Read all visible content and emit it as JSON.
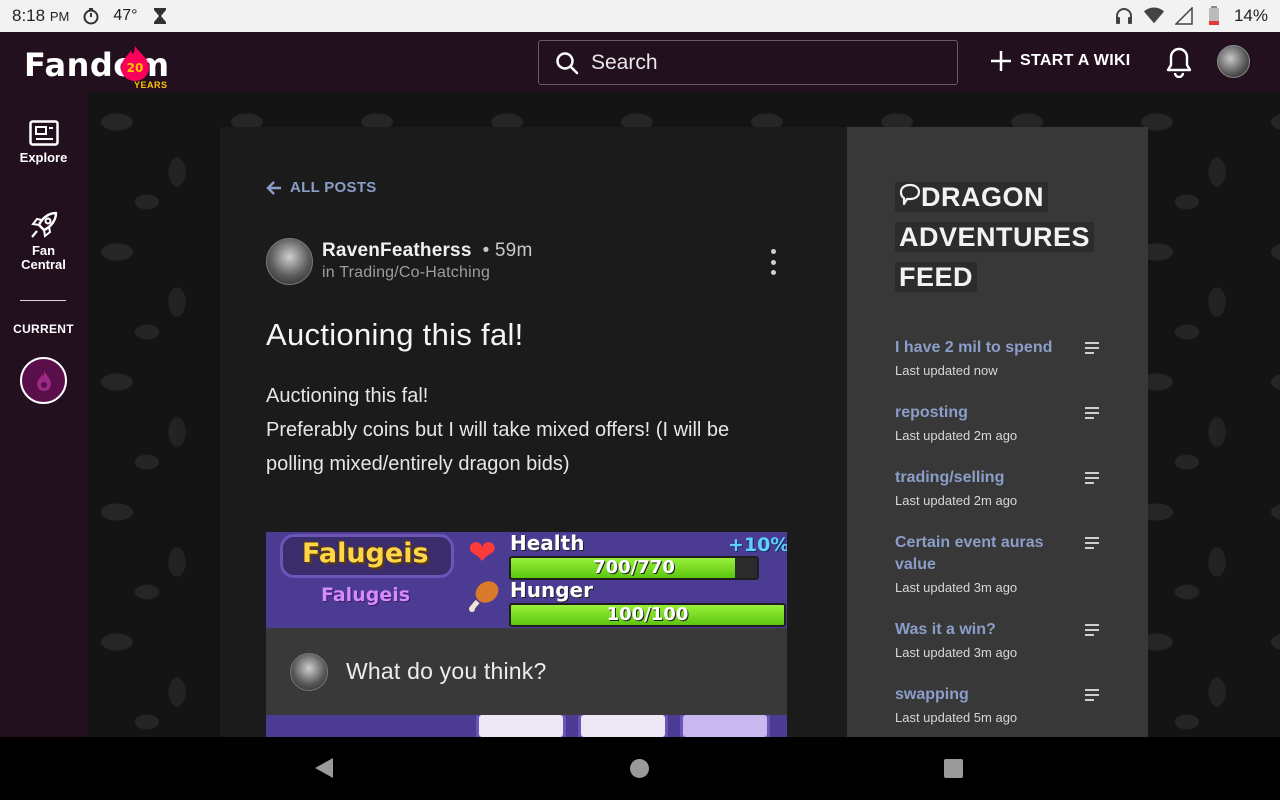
{
  "status_bar": {
    "time": "8:18",
    "ampm": "PM",
    "temperature": "47°",
    "battery": "14%"
  },
  "nav": {
    "logo_text": "Fandom",
    "logo_badge": "20",
    "logo_years": "YEARS",
    "search_placeholder": "Search",
    "start_wiki": "START A WIKI"
  },
  "rail": {
    "explore": "Explore",
    "fan_central_line1": "Fan",
    "fan_central_line2": "Central",
    "current": "CURRENT"
  },
  "post": {
    "back_label": "ALL POSTS",
    "author": "RavenFeatherss",
    "time_ago": "59m",
    "category_prefix": "in",
    "category": "Trading/Co-Hatching",
    "title": "Auctioning this fal!",
    "body_line1": "Auctioning this fal!",
    "body_line2": "Preferably coins but I will take mixed offers! (I will be polling mixed/entirely dragon bids)"
  },
  "post_image": {
    "dragon_name": "Falugeis",
    "dragon_subname": "Falugeis",
    "health_label": "Health",
    "health_bonus": "+10%",
    "health_value": "700/770",
    "health_fraction": 0.909,
    "hunger_label": "Hunger",
    "hunger_value": "100/100",
    "hunger_fraction": 1.0
  },
  "comment": {
    "placeholder": "What do you think?"
  },
  "feed": {
    "title_line1": "DRAGON",
    "title_line2": "ADVENTURES",
    "title_line3": "FEED",
    "items": [
      {
        "title": "I have 2 mil to spend",
        "updated": "Last updated now"
      },
      {
        "title": "reposting",
        "updated": "Last updated 2m ago"
      },
      {
        "title": "trading/selling",
        "updated": "Last updated 2m ago"
      },
      {
        "title": "Certain event auras value",
        "updated": "Last updated 3m ago"
      },
      {
        "title": "Was it a win?",
        "updated": "Last updated 3m ago"
      },
      {
        "title": "swapping",
        "updated": "Last updated 5m ago"
      }
    ]
  },
  "colors": {
    "nav_bg": "#22101f",
    "link_blue": "#8a9ec9",
    "card_bg": "#1c1b1b",
    "feed_bg": "#393838"
  }
}
